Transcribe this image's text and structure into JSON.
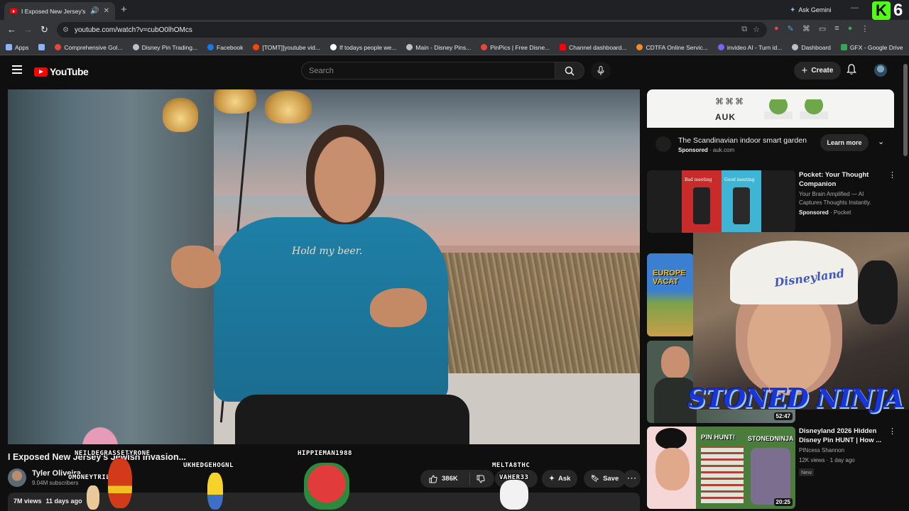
{
  "browser": {
    "tab_title": "I Exposed New Jersey's Jew",
    "ask_gemini": "Ask Gemini",
    "url": "youtube.com/watch?v=cubO0lhOMcs",
    "kick_digit": "6",
    "bookmarks": [
      {
        "label": "Apps",
        "color": "#8ab4f8"
      },
      {
        "label": "",
        "color": "#8ab4f8"
      },
      {
        "label": "Comprehensive Gol...",
        "color": "#e8453c"
      },
      {
        "label": "Disney Pin Trading...",
        "color": "#bdc1c6"
      },
      {
        "label": "Facebook",
        "color": "#1877f2"
      },
      {
        "label": "[TOMT]]youtube vid...",
        "color": "#ff4500"
      },
      {
        "label": "If todays people we...",
        "color": "#ffffff"
      },
      {
        "label": "Main - Disney Pins...",
        "color": "#bdc1c6"
      },
      {
        "label": "PinPics | Free Disne...",
        "color": "#e8453c"
      },
      {
        "label": "Channel dashboard...",
        "color": "#ff0000"
      },
      {
        "label": "CDTFA Online Servic...",
        "color": "#f08c2a"
      },
      {
        "label": "invideo AI - Turn id...",
        "color": "#7b61ff"
      },
      {
        "label": "Dashboard",
        "color": "#bdc1c6"
      },
      {
        "label": "GFX - Google Drive",
        "color": "#34a853"
      }
    ]
  },
  "youtube": {
    "logo": "YouTube",
    "search_placeholder": "Search",
    "create_label": "Create"
  },
  "video": {
    "shirt_text": "Hold my beer.",
    "title": "I Exposed New Jersey's Jewish Invasion...",
    "channel_name": "Tyler Oliveira",
    "subscribers": "9.04M subscribers",
    "likes": "386K",
    "ask_label": "Ask",
    "save_label": "Save",
    "views": "7M views",
    "age": "11 days ago"
  },
  "chat_overlay": [
    {
      "name": "NEILDEGRASSETYRONE"
    },
    {
      "name": "OMONEYTRILL"
    },
    {
      "name": "UKHEDGEHOGNL"
    },
    {
      "name": "HIPPIEMAN1988"
    },
    {
      "name": "MELTA8THC"
    },
    {
      "name": "VAHER33"
    }
  ],
  "ad": {
    "banner_brand": "AUK",
    "title": "The Scandinavian indoor smart garden",
    "sponsored": "Sponsored",
    "domain": "auk.com",
    "cta": "Learn more"
  },
  "recommendations": [
    {
      "title": "Pocket: Your Thought Companion",
      "line1": "Your Brain Amplified — AI Captures Thoughts Instantly.",
      "line2_bold": "Sponsored",
      "line2": "· Pocket",
      "thumb_left_caption": "Bad meeting",
      "thumb_right_caption": "Good meeting"
    },
    {
      "thumb_text": "EUROPE VACAT"
    },
    {
      "duration": "52:47"
    },
    {
      "title": "Disneyland 2026 Hidden Disney Pin HUNT | How ...",
      "channel": "PINcess Shannon",
      "meta": "12K views · 1 day ago",
      "badge": "New",
      "thumb_text_1": "PIN HUNT!",
      "thumb_text_2": "STONEDNINJA",
      "duration": "20:25"
    }
  ],
  "webcam": {
    "cap_text": "Disneyland",
    "streamer_banner": "STONED NINJA"
  }
}
